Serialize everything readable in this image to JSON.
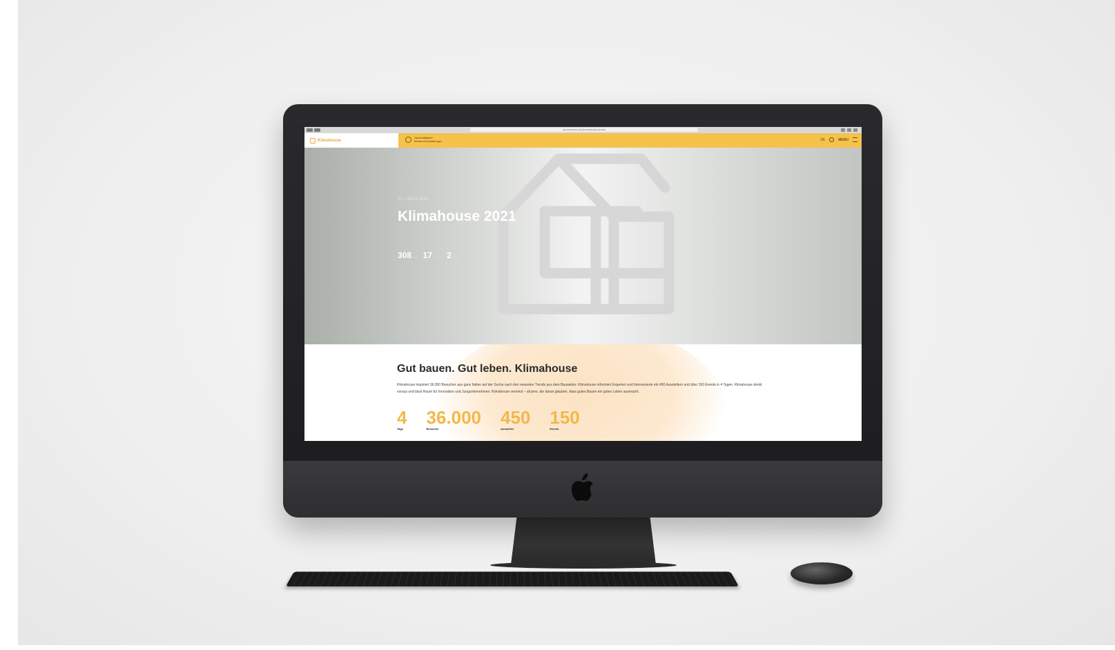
{
  "browser": {
    "url": "www.klimahouse.it/de/events/klimahouse-2021"
  },
  "nav": {
    "logo_text": "Klimahouse",
    "badge_text": "Nachhaltigkeit / Messeveranstaltungen",
    "lang": "DE",
    "menu_label": "MENU"
  },
  "hero": {
    "dates": "27.—30.01.2021",
    "title": "Klimahouse 2021",
    "countdown": [
      {
        "value": "308",
        "unit": "Tage"
      },
      {
        "value": "17",
        "unit": "Stunden"
      },
      {
        "value": "2",
        "unit": "Minuten"
      }
    ]
  },
  "content": {
    "title": "Gut bauen. Gut leben. Klimahouse",
    "body": "Klimahouse inspiriert 36.000 Besucher aus ganz Italien auf der Suche nach den neuesten Trends aus dem Bausektor. Klimahouse informiert Experten und Interessierte mit 450 Ausstellern und über 150 Events in 4 Tagen. Klimahouse denkt voraus und lässt Raum für Innovation und Jungunternehmen. Klimahouse vernetzt – all jene, die daran glauben, dass gutes Bauen ein gutes Leben ausmacht.",
    "stats": [
      {
        "value": "4",
        "label": "Tage"
      },
      {
        "value": "36.000",
        "label": "Besucher"
      },
      {
        "value": "450",
        "label": "Aussteller"
      },
      {
        "value": "150",
        "label": "Events"
      }
    ]
  },
  "colors": {
    "accent": "#f5c24c",
    "stat": "#f2b84a",
    "device": "#2a2a2c"
  }
}
